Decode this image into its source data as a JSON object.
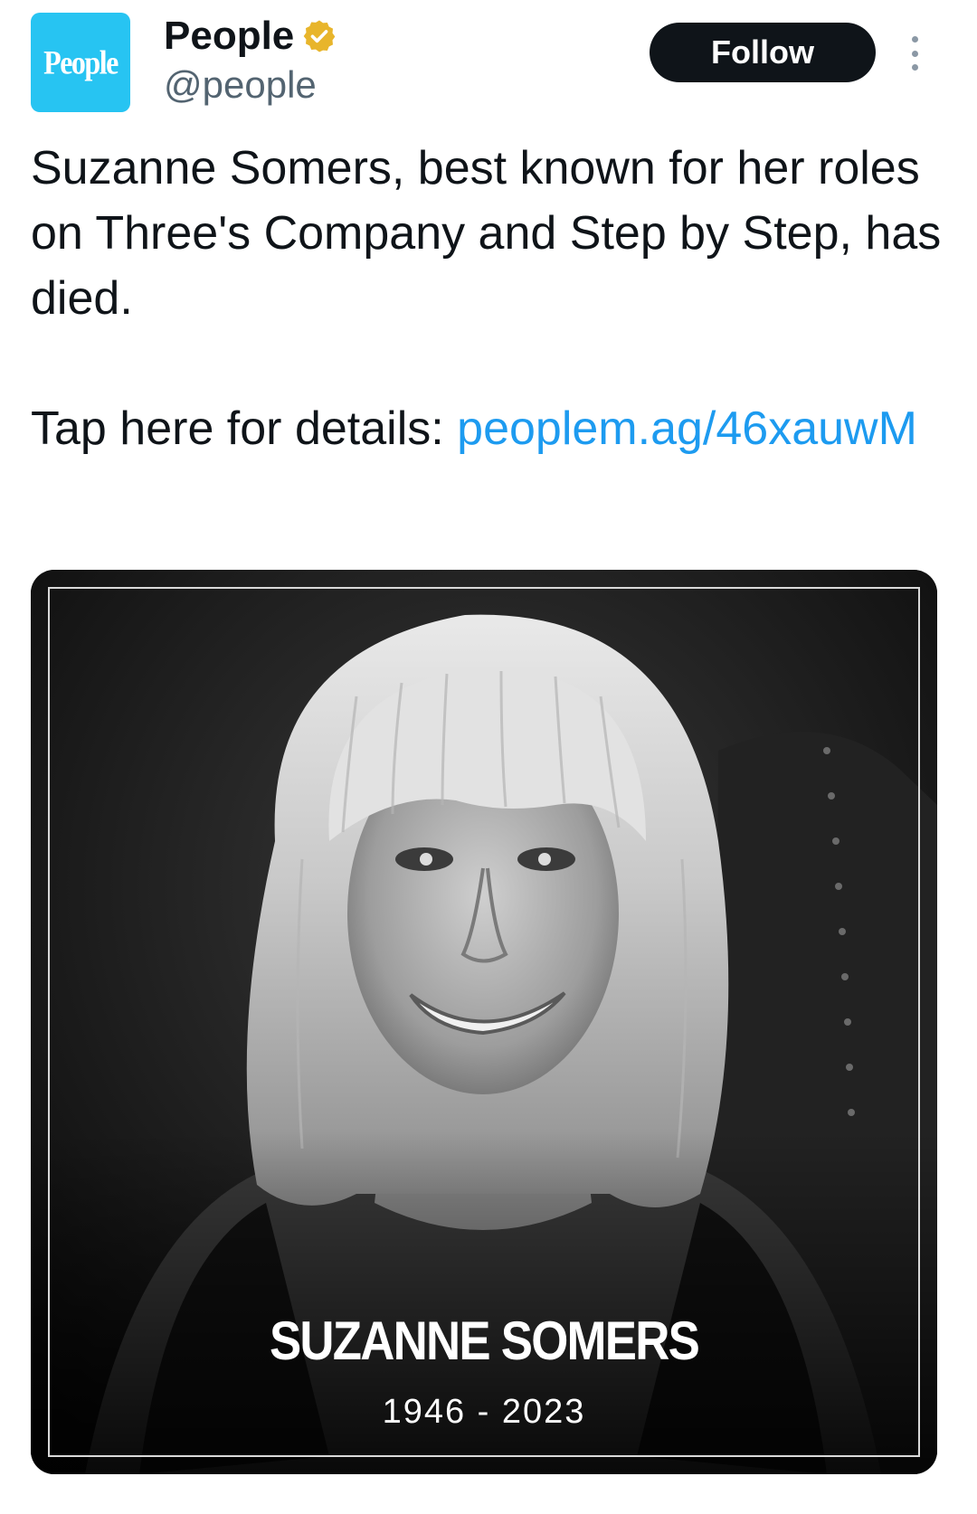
{
  "account": {
    "avatar_logo": "People",
    "display_name": "People",
    "handle": "@people",
    "verified_color": "#e8b52b"
  },
  "actions": {
    "follow_label": "Follow",
    "more_icon": "more-vertical-icon"
  },
  "tweet": {
    "text_line1": "Suzanne Somers, best known for her roles on Three's Company and Step by Step, has died.",
    "text_prefix": "Tap here for details: ",
    "link_text": "peoplem.ag/​46xauwM"
  },
  "media": {
    "photo_description_icon": "portrait-photo",
    "overlay_name": "SUZANNE SOMERS",
    "overlay_dates": "1946 - 2023"
  },
  "colors": {
    "brand_avatar": "#27c4f2",
    "link": "#1d9bf0",
    "text": "#0f1419",
    "secondary": "#536471"
  }
}
